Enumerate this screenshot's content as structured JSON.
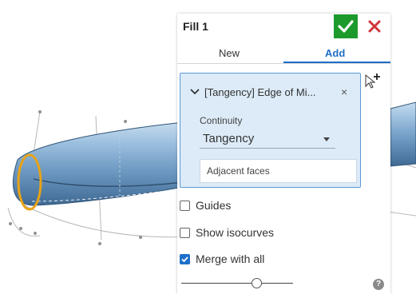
{
  "dialog": {
    "title": "Fill 1",
    "accept_icon": "checkmark-icon",
    "cancel_icon": "close-x-icon",
    "accept_color": "#1d9a2c",
    "cancel_color": "#d0343a"
  },
  "tabs": [
    {
      "label": "New",
      "active": false
    },
    {
      "label": "Add",
      "active": true
    }
  ],
  "selection": {
    "label": "[Tangency] Edge of Mi...",
    "close_glyph": "×",
    "continuity_label": "Continuity",
    "continuity_value": "Tangency",
    "adjacent_faces_placeholder": "Adjacent faces"
  },
  "options": {
    "guides": {
      "label": "Guides",
      "checked": false
    },
    "show_isocurves": {
      "label": "Show isocurves",
      "checked": false
    },
    "merge_with_all": {
      "label": "Merge with all",
      "checked": true
    }
  },
  "slider": {
    "value": 0.67
  },
  "help_glyph": "?",
  "accent_color": "#1e6fc8",
  "selection_color": "#e8a317"
}
